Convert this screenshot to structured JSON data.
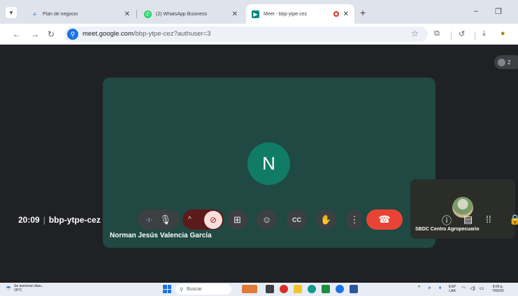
{
  "browser": {
    "tabs": [
      {
        "title": "Plan de negocio",
        "favicon": "plan-icon",
        "color": "#1a73e8"
      },
      {
        "title": "(2) WhatsApp Business",
        "favicon": "whatsapp-icon",
        "color": "#25d366"
      },
      {
        "title": "Meet - bbp-ytpe-cez",
        "favicon": "meet-icon",
        "color": "#00897b",
        "active": true
      }
    ],
    "new_tab": "+",
    "window": {
      "minimize": "–",
      "restore": "❐"
    },
    "url": {
      "host": "meet.google.com",
      "path": "/bbp-ytpe-cez?authuser=3"
    }
  },
  "meet": {
    "participant_count": "2",
    "main_tile": {
      "initial": "N",
      "name": "Norman Jesús Valencia García",
      "bg": "#1f4942",
      "avatar_color": "#117c66"
    },
    "self_tile": {
      "name": "SBDC Centro Agropecuario"
    },
    "clock": "20:09",
    "divider": "|",
    "meeting_code": "bbp-ytpe-cez",
    "hangup_color": "#ea4335"
  },
  "taskbar": {
    "weather_line1": "Se avecinan días...",
    "weather_line2": "18°C",
    "search_label": "Buscar",
    "lang_line1": "ESP",
    "lang_line2": "LAA",
    "time": "8:09 p.",
    "date": "7/05/20"
  }
}
